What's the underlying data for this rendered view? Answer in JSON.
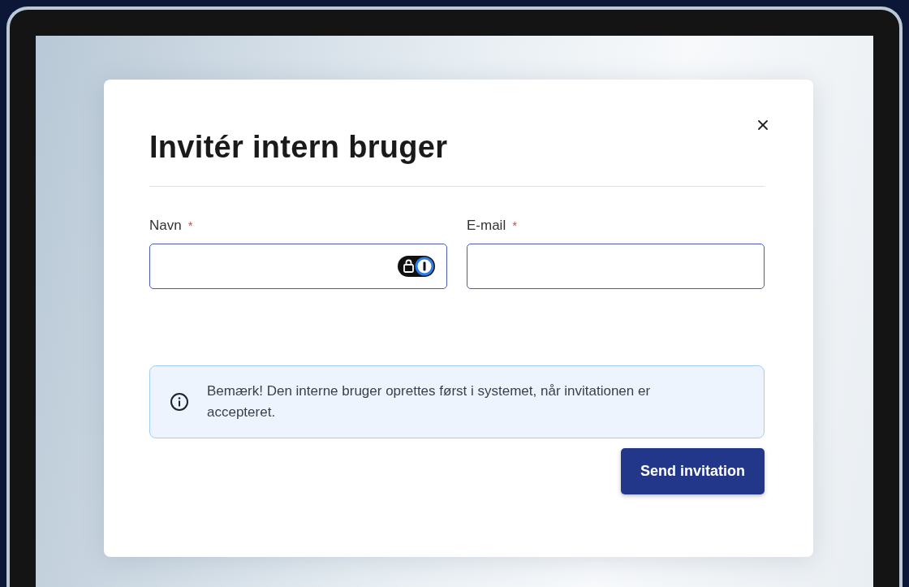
{
  "dialog": {
    "title": "Invitér intern bruger",
    "fields": [
      {
        "label": "Navn",
        "required_mark": "*",
        "kind": "password-manager"
      },
      {
        "label": "E-mail",
        "required_mark": "*",
        "kind": "plain"
      }
    ],
    "notice": {
      "text": "Bemærk! Den interne bruger oprettes først i systemet, når invitationen er accepteret."
    },
    "buttons": [
      "Send invitation"
    ]
  }
}
